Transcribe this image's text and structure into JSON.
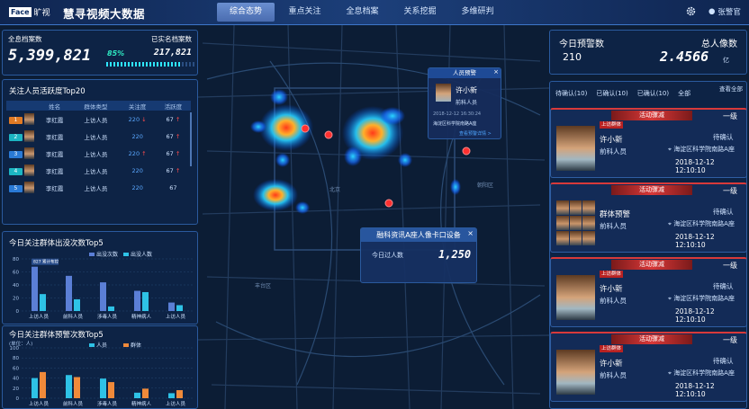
{
  "header": {
    "logo_box": "Face",
    "logo_name": "旷视",
    "title": "慧寻视频大数据",
    "tabs": [
      "综合态势",
      "重点关注",
      "全息档案",
      "关系挖掘",
      "多维研判"
    ],
    "active_tab": "综合态势",
    "user": "张警官"
  },
  "stats": {
    "total_label": "全息档案数",
    "total_value": "5,399,821",
    "real_label": "已实名档案数",
    "real_value": "217,821",
    "pct": "85%",
    "pct_value": 0.85
  },
  "top20": {
    "title": "关注人员活跃度Top20",
    "cols": [
      "姓名",
      "群体类型",
      "关注度",
      "活跃度"
    ],
    "rows": [
      {
        "rank": "1",
        "name": "李红霞",
        "type": "上访人员",
        "att": "220",
        "att_arrow": "↓",
        "act": "67",
        "act_arrow": "↑",
        "rank_color": "#e07a24"
      },
      {
        "rank": "2",
        "name": "李红霞",
        "type": "上访人员",
        "att": "220",
        "att_arrow": "",
        "act": "67",
        "act_arrow": "↑",
        "rank_color": "#1cb5c2"
      },
      {
        "rank": "3",
        "name": "李红霞",
        "type": "上访人员",
        "att": "220",
        "att_arrow": "↑",
        "act": "67",
        "act_arrow": "↑",
        "rank_color": "#2a7ad6"
      },
      {
        "rank": "4",
        "name": "李红霞",
        "type": "上访人员",
        "att": "220",
        "att_arrow": "",
        "act": "67",
        "act_arrow": "↑",
        "rank_color": "#1cb5c2"
      },
      {
        "rank": "5",
        "name": "李红霞",
        "type": "上访人员",
        "att": "220",
        "att_arrow": "",
        "act": "67",
        "act_arrow": "",
        "rank_color": "#2a7ad6"
      }
    ]
  },
  "chart1": {
    "title": "今日关注群体出没次数Top5"
  },
  "chart2": {
    "title": "今日关注群体预警次数Top5",
    "unit": "(单位：人)"
  },
  "chart_data": [
    {
      "type": "bar",
      "title": "今日关注群体出没次数Top5",
      "categories": [
        "上访人员",
        "前科人员",
        "涉毒人员",
        "精神病人",
        "上访人员"
      ],
      "series": [
        {
          "name": "出没次数",
          "values": [
            68,
            54,
            44,
            31,
            13
          ],
          "color": "#5b7fd6"
        },
        {
          "name": "出没人数",
          "values": [
            26,
            18,
            7,
            29,
            9
          ],
          "color": "#2ec2e6"
        }
      ],
      "ylim": [
        0,
        80
      ],
      "yticks": [
        0,
        20,
        40,
        60,
        80
      ],
      "annotation": "827 累计布控"
    },
    {
      "type": "bar",
      "title": "今日关注群体预警次数Top5",
      "categories": [
        "上访人员",
        "前科人员",
        "涉毒人员",
        "精神病人",
        "上访人员"
      ],
      "series": [
        {
          "name": "人员",
          "values": [
            40,
            46,
            39,
            11,
            10
          ],
          "color": "#2ec2e6"
        },
        {
          "name": "群体",
          "values": [
            52,
            42,
            32,
            19,
            16
          ],
          "color": "#f08a3a"
        }
      ],
      "ylim": [
        0,
        100
      ],
      "yticks": [
        0,
        20,
        40,
        60,
        80,
        100
      ]
    }
  ],
  "right": {
    "today_label": "今日预警数",
    "today_value": "210",
    "total_label": "总人像数",
    "total_value": "2.4566",
    "total_unit": "亿",
    "tabs": [
      "待确认(10)",
      "已确认(10)",
      "已确认(10)",
      "全部"
    ],
    "view_all": "查看全部",
    "cards": [
      {
        "tag": "活动骤减",
        "level": "一级",
        "badge": "上访群体",
        "name": "许小新",
        "role": "前科人员",
        "status": "待确认",
        "location": "海淀区科学院南路A座",
        "time": "2018-12-12 12:10:10",
        "group": false
      },
      {
        "tag": "活动骤减",
        "level": "一级",
        "badge": "",
        "name": "群体预警",
        "role": "前科人员",
        "status": "待确认",
        "location": "海淀区科学院南路A座",
        "time": "2018-12-12 12:10:10",
        "group": true
      },
      {
        "tag": "活动骤减",
        "level": "一级",
        "badge": "上访群体",
        "name": "许小新",
        "role": "前科人员",
        "status": "待确认",
        "location": "海淀区科学院南路A座",
        "time": "2018-12-12 12:10:10",
        "group": false
      },
      {
        "tag": "活动骤减",
        "level": "一级",
        "badge": "上访群体",
        "name": "许小新",
        "role": "前科人员",
        "status": "待确认",
        "location": "海淀区科学院南路A座",
        "time": "2018-12-12 12:10:10",
        "group": false
      }
    ]
  },
  "popup1": {
    "title": "人员预警",
    "name": "许小新",
    "role": "前科人员",
    "time": "2018-12-12 16:30:24",
    "loc": "海淀区科学院南路A座",
    "link": "查看预警详情 >"
  },
  "popup2": {
    "title": "融科资讯A座人像卡口设备",
    "label": "今日过人数",
    "value": "1,250"
  }
}
